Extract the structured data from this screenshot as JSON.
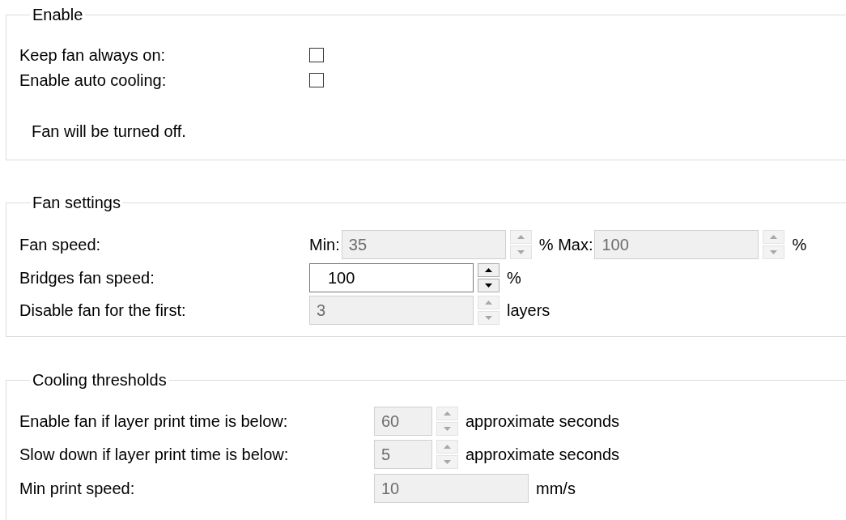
{
  "groups": [
    {
      "title": "Enable",
      "rows": [
        {
          "kind": "checkbox",
          "label": "Keep fan always on:",
          "checked": false
        },
        {
          "kind": "checkbox",
          "label": "Enable auto cooling:",
          "checked": false
        },
        {
          "kind": "note",
          "text": "Fan will be turned off."
        }
      ]
    },
    {
      "title": "Fan settings",
      "rows": [
        {
          "kind": "inputs",
          "label": "Fan speed:",
          "items": [
            {
              "kind": "text",
              "text": "Min:"
            },
            {
              "kind": "field",
              "value": "35",
              "disabled": true,
              "spinner": true
            },
            {
              "kind": "text",
              "text": "% Max:"
            },
            {
              "kind": "field",
              "value": "100",
              "disabled": true,
              "spinner": true
            },
            {
              "kind": "text",
              "text": "%"
            }
          ]
        },
        {
          "kind": "inputs",
          "label": "Bridges fan speed:",
          "items": [
            {
              "kind": "field",
              "value": "100",
              "disabled": false,
              "spinner": true
            },
            {
              "kind": "text",
              "text": "%"
            }
          ]
        },
        {
          "kind": "inputs",
          "label": "Disable fan for the first:",
          "items": [
            {
              "kind": "field",
              "value": "3",
              "disabled": true,
              "spinner": true
            },
            {
              "kind": "text",
              "text": "layers"
            }
          ]
        }
      ]
    },
    {
      "title": "Cooling thresholds",
      "rows": [
        {
          "kind": "inputs",
          "label": "Enable fan if layer print time is below:",
          "items": [
            {
              "kind": "field",
              "value": "60",
              "disabled": true,
              "spinner": true
            },
            {
              "kind": "text",
              "text": "approximate seconds"
            }
          ]
        },
        {
          "kind": "inputs",
          "label": "Slow down if layer print time is below:",
          "items": [
            {
              "kind": "field",
              "value": "5",
              "disabled": true,
              "spinner": true
            },
            {
              "kind": "text",
              "text": "approximate seconds"
            }
          ]
        },
        {
          "kind": "inputs",
          "label": "Min print speed:",
          "items": [
            {
              "kind": "field",
              "value": "10",
              "disabled": true,
              "spinner": false
            },
            {
              "kind": "text",
              "text": "mm/s"
            }
          ]
        }
      ]
    }
  ]
}
